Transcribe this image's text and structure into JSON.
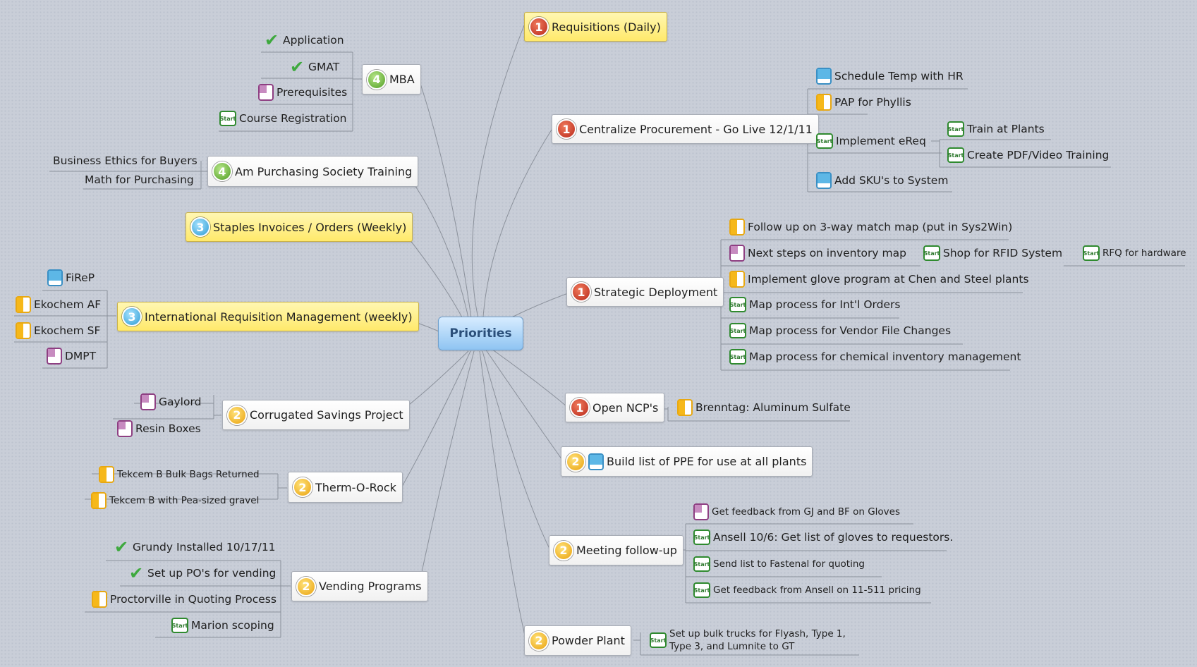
{
  "central": {
    "label": "Priorities"
  },
  "topics": {
    "mba": {
      "label": "MBA",
      "priority": "4",
      "items": [
        {
          "label": "Application",
          "icon": "checkmark-icon"
        },
        {
          "label": "GMAT",
          "icon": "checkmark-icon"
        },
        {
          "label": "Prerequisites",
          "icon": "task-quarter-icon"
        },
        {
          "label": "Course Registration",
          "icon": "start-icon",
          "icon_text": "Start"
        }
      ]
    },
    "aps": {
      "label": "Am Purchasing Society Training",
      "priority": "4",
      "items": [
        {
          "label": "Business Ethics for Buyers"
        },
        {
          "label": "Math for Purchasing"
        }
      ]
    },
    "staples": {
      "label": "Staples Invoices / Orders (Weekly)",
      "priority": "3"
    },
    "irm": {
      "label": "International Requisition Management (weekly)",
      "priority": "3",
      "items": [
        {
          "label": "FiReP",
          "icon": "task-three-quarter-icon"
        },
        {
          "label": "Ekochem AF",
          "icon": "task-half-icon"
        },
        {
          "label": "Ekochem SF",
          "icon": "task-half-icon"
        },
        {
          "label": "DMPT",
          "icon": "task-quarter-icon"
        }
      ]
    },
    "corrugated": {
      "label": "Corrugated Savings Project",
      "priority": "2",
      "items": [
        {
          "label": "Gaylord",
          "icon": "task-quarter-icon"
        },
        {
          "label": "Resin Boxes",
          "icon": "task-quarter-icon"
        }
      ]
    },
    "thermorock": {
      "label": "Therm-O-Rock",
      "priority": "2",
      "items": [
        {
          "label": "Tekcem B Bulk Bags Returned",
          "icon": "task-half-icon"
        },
        {
          "label": "Tekcem B with Pea-sized gravel",
          "icon": "task-half-icon"
        }
      ]
    },
    "vending": {
      "label": "Vending Programs",
      "priority": "2",
      "items": [
        {
          "label": "Grundy Installed 10/17/11",
          "icon": "checkmark-icon"
        },
        {
          "label": "Set up PO's for vending",
          "icon": "checkmark-icon"
        },
        {
          "label": "Proctorville in Quoting Process",
          "icon": "task-half-icon"
        },
        {
          "label": "Marion scoping",
          "icon": "start-icon",
          "icon_text": "Start"
        }
      ]
    },
    "requisitions": {
      "label": "Requisitions (Daily)",
      "priority": "1"
    },
    "centralize": {
      "label": "Centralize Procurement - Go Live 12/1/11",
      "priority": "1",
      "items": [
        {
          "label": "Schedule Temp with HR",
          "icon": "task-three-quarter-icon"
        },
        {
          "label": "PAP for Phyllis",
          "icon": "task-half-icon"
        },
        {
          "label": "Implement eReq",
          "icon": "start-icon",
          "icon_text": "Start",
          "children": [
            {
              "label": "Train at Plants",
              "icon": "start-icon",
              "icon_text": "Start"
            },
            {
              "label": "Create PDF/Video Training",
              "icon": "start-icon",
              "icon_text": "Start"
            }
          ]
        },
        {
          "label": "Add SKU's to System",
          "icon": "task-three-quarter-icon"
        }
      ]
    },
    "strategic": {
      "label": "Strategic Deployment",
      "priority": "1",
      "items": [
        {
          "label": "Follow up on 3-way match map (put in Sys2Win)",
          "icon": "task-half-icon"
        },
        {
          "label": "Next steps on inventory map",
          "icon": "task-quarter-icon",
          "child": {
            "label": "Shop for RFID System",
            "icon": "start-icon",
            "icon_text": "Start",
            "child": {
              "label": "RFQ for hardware",
              "icon": "start-icon",
              "icon_text": "Start"
            }
          }
        },
        {
          "label": "Implement glove program at Chen and Steel plants",
          "icon": "task-half-icon"
        },
        {
          "label": "Map process for Int'l Orders",
          "icon": "start-icon",
          "icon_text": "Start"
        },
        {
          "label": "Map process for Vendor File Changes",
          "icon": "start-icon",
          "icon_text": "Start"
        },
        {
          "label": "Map process for chemical inventory management",
          "icon": "start-icon",
          "icon_text": "Start"
        }
      ]
    },
    "ncp": {
      "label": "Open NCP's",
      "priority": "1",
      "items": [
        {
          "label": "Brenntag: Aluminum Sulfate",
          "icon": "task-half-icon"
        }
      ]
    },
    "ppe": {
      "label": "Build list of PPE for use at all plants",
      "priority": "2",
      "icon": "task-three-quarter-icon"
    },
    "meeting": {
      "label": "Meeting follow-up",
      "priority": "2",
      "items": [
        {
          "label": "Get feedback from GJ and BF on Gloves",
          "icon": "task-quarter-icon"
        },
        {
          "label": "Ansell 10/6: Get list of gloves to requestors.",
          "icon": "start-icon",
          "icon_text": "Start"
        },
        {
          "label": "Send list to Fastenal for quoting",
          "icon": "start-icon",
          "icon_text": "Start"
        },
        {
          "label": "Get feedback from Ansell on 11-511 pricing",
          "icon": "start-icon",
          "icon_text": "Start"
        }
      ]
    },
    "powder": {
      "label": "Powder Plant",
      "priority": "2",
      "items": [
        {
          "label_line1": "Set up bulk trucks for Flyash, Type 1,",
          "label_line2": "Type 3, and Lumnite to GT",
          "icon": "start-icon",
          "icon_text": "Start"
        }
      ]
    }
  }
}
